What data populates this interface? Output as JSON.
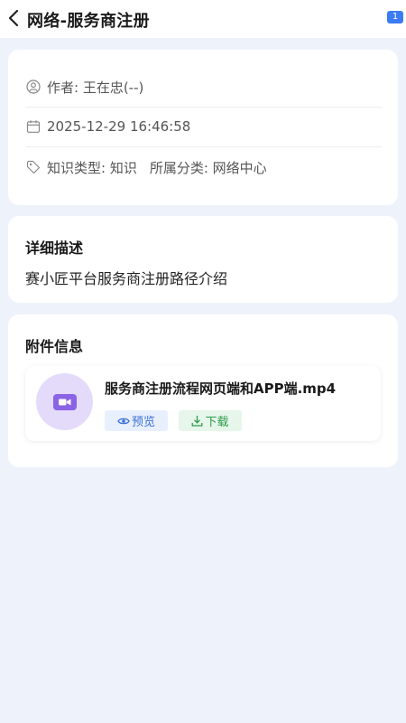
{
  "header": {
    "title": "网络-服务商注册",
    "badge": "1"
  },
  "info": {
    "author": "作者: 王在忠(--)",
    "datetime": "2025-12-29 16:46:58",
    "category_type": "知识类型:  知识",
    "category_group": "所属分类: 网络中心"
  },
  "description": {
    "title": "详细描述",
    "text": "赛小匠平台服务商注册路径介绍"
  },
  "attachments": {
    "title": "附件信息",
    "file_name": "服务商注册流程网页端和APP端.mp4",
    "preview_label": "预览",
    "download_label": "下载"
  },
  "colors": {
    "background": "#eef3fb",
    "accent": "#3b7cf4",
    "preview_text": "#3a6fd6",
    "download_text": "#2e9a4b",
    "video_icon": "#8a63e6"
  }
}
